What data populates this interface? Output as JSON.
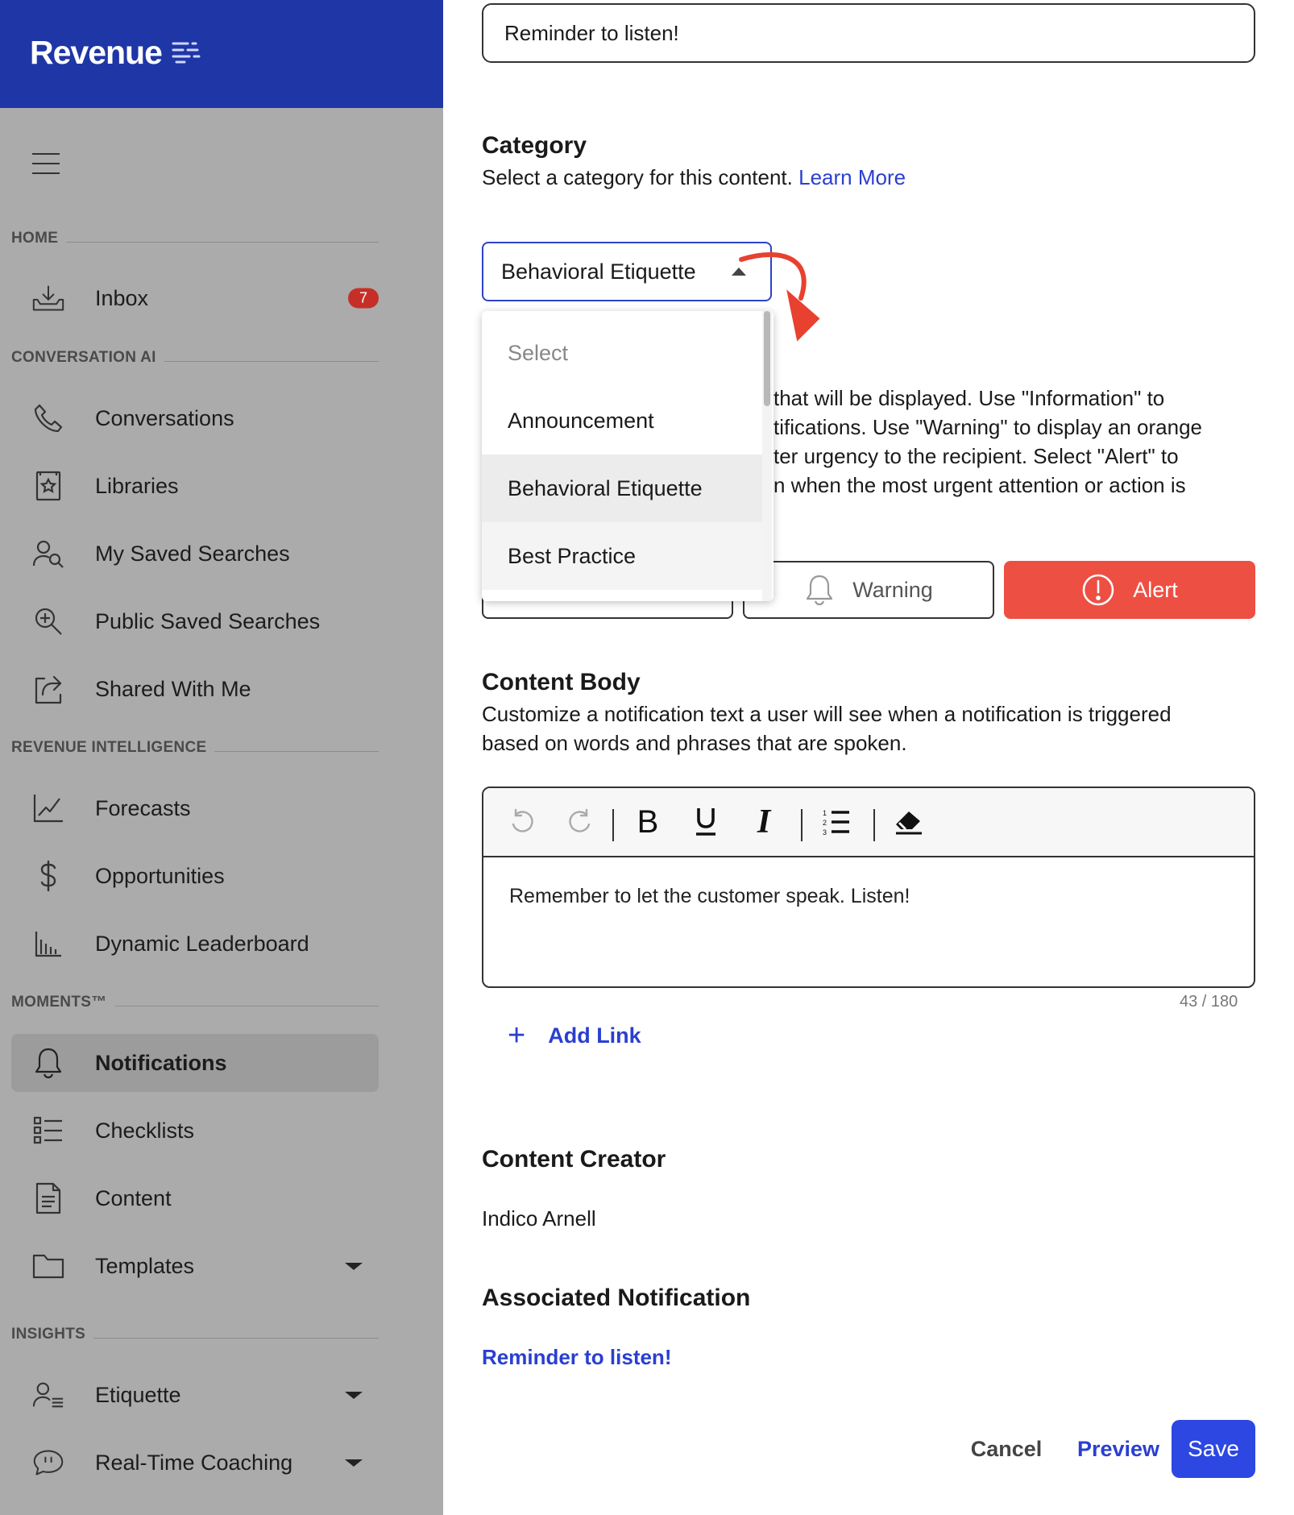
{
  "brand": {
    "name": "Revenue"
  },
  "sidebar": {
    "sections": {
      "home": "HOME",
      "conversation_ai": "CONVERSATION AI",
      "revenue_intelligence": "REVENUE INTELLIGENCE",
      "moments": "MOMENTS™",
      "insights": "INSIGHTS"
    },
    "items": {
      "inbox": {
        "label": "Inbox",
        "badge": "7"
      },
      "conversations": {
        "label": "Conversations"
      },
      "libraries": {
        "label": "Libraries"
      },
      "my_saved_searches": {
        "label": "My Saved Searches"
      },
      "public_saved_searches": {
        "label": "Public Saved Searches"
      },
      "shared_with_me": {
        "label": "Shared With Me"
      },
      "forecasts": {
        "label": "Forecasts"
      },
      "opportunities": {
        "label": "Opportunities"
      },
      "dynamic_leaderboard": {
        "label": "Dynamic Leaderboard"
      },
      "notifications": {
        "label": "Notifications"
      },
      "checklists": {
        "label": "Checklists"
      },
      "content": {
        "label": "Content"
      },
      "templates": {
        "label": "Templates"
      },
      "etiquette": {
        "label": "Etiquette"
      },
      "real_time_coaching": {
        "label": "Real-Time Coaching"
      }
    },
    "active": "Notifications"
  },
  "form": {
    "title_value": "Reminder to listen!",
    "category": {
      "heading": "Category",
      "description": "Select a category for this content.",
      "learn_more": "Learn More",
      "selected": "Behavioral Etiquette",
      "options": [
        "Select",
        "Announcement",
        "Behavioral Etiquette",
        "Best Practice"
      ]
    },
    "severity": {
      "desc_line1": "that will be displayed. Use \"Information\" to",
      "desc_line2": "tifications. Use \"Warning\" to display an orange",
      "desc_line3": "ter urgency to the recipient. Select \"Alert\" to",
      "desc_line4": "n when the most urgent attention or action is",
      "warning_label": "Warning",
      "alert_label": "Alert",
      "selected": "Alert"
    },
    "content_body": {
      "heading": "Content Body",
      "description_line1": "Customize a notification text a user will see when a notification is triggered",
      "description_line2": "based on words and phrases that are spoken.",
      "text": "Remember to let the customer speak. Listen!",
      "counter": "43 / 180",
      "add_link": "Add Link"
    },
    "content_creator": {
      "heading": "Content Creator",
      "name": "Indico Arnell"
    },
    "associated_notification": {
      "heading": "Associated Notification",
      "link": "Reminder to listen!"
    }
  },
  "footer": {
    "cancel": "Cancel",
    "preview": "Preview",
    "save": "Save"
  },
  "colors": {
    "brand_bar": "#1f36a6",
    "accent": "#2a3fd0",
    "alert": "#ee4f43",
    "save": "#2c47e2",
    "annotation_arrow": "#e8412f"
  }
}
